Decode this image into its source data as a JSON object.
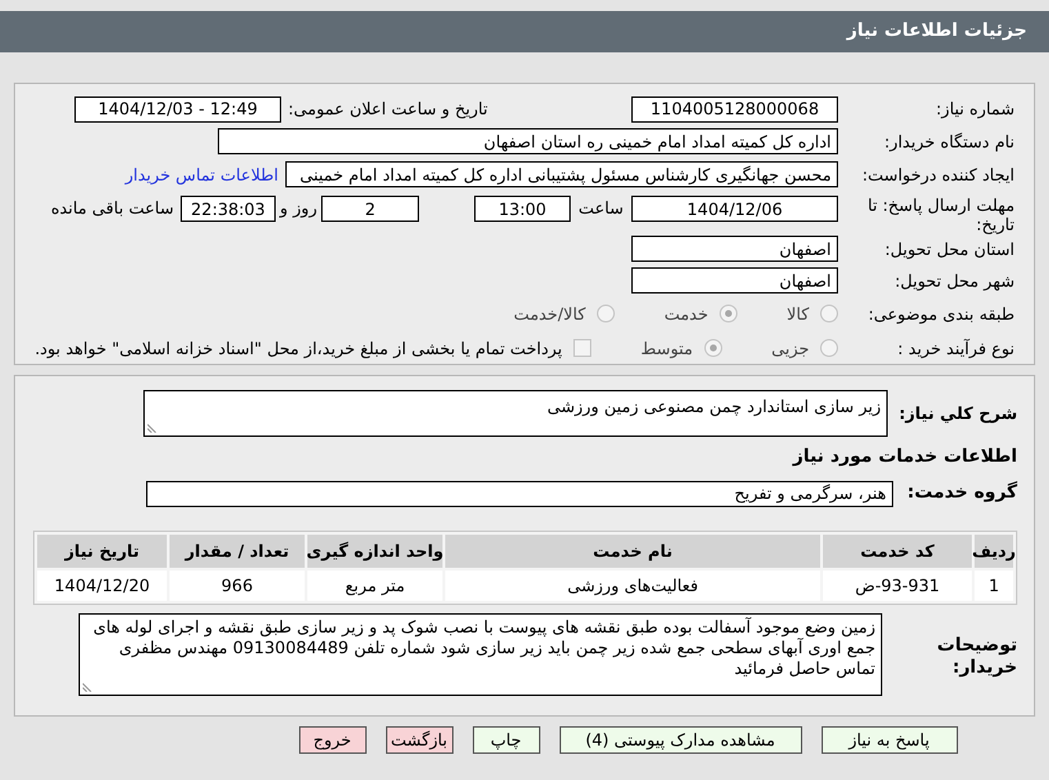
{
  "header": {
    "title": "جزئیات اطلاعات نیاز"
  },
  "details": {
    "need_number": {
      "label": "شماره نیاز:",
      "value": "1104005128000068"
    },
    "announce_datetime": {
      "label": "تاریخ و ساعت اعلان عمومی:",
      "value": "1404/12/03 - 12:49"
    },
    "buyer_org": {
      "label": "نام دستگاه خریدار:",
      "value": "اداره کل کمیته امداد امام خمینی  ره  استان اصفهان"
    },
    "requester": {
      "label": "ایجاد کننده درخواست:",
      "value": "محسن جهانگیری کارشناس مسئول پشتیبانی اداره کل کمیته امداد امام خمینی",
      "contact_link": "اطلاعات تماس خریدار"
    },
    "deadline": {
      "label": "مهلت ارسال پاسخ: تا تاریخ:",
      "date": "1404/12/06",
      "time_label": "ساعت",
      "time": "13:00",
      "days": "2",
      "days_label": "روز و",
      "remaining": "22:38:03",
      "remaining_label": "ساعت باقی مانده"
    },
    "province": {
      "label": "استان محل تحویل:",
      "value": "اصفهان"
    },
    "city": {
      "label": "شهر محل تحویل:",
      "value": "اصفهان"
    },
    "category": {
      "label": "طبقه بندی موضوعی:",
      "options": [
        {
          "label": "کالا",
          "selected": false
        },
        {
          "label": "خدمت",
          "selected": true
        },
        {
          "label": "کالا/خدمت",
          "selected": false
        }
      ]
    },
    "process": {
      "label": "نوع فرآیند خرید :",
      "options": [
        {
          "label": "جزیی",
          "selected": false
        },
        {
          "label": "متوسط",
          "selected": true
        }
      ],
      "treasury": {
        "checked": false,
        "text": "پرداخت تمام یا بخشی از مبلغ خرید،از محل \"اسناد خزانه اسلامی\" خواهد بود."
      }
    }
  },
  "description": {
    "label": "شرح کلي نیاز:",
    "value": "زیر سازی استاندارد چمن مصنوعی زمین ورزشی"
  },
  "services_heading": "اطلاعات خدمات مورد نیاز",
  "service_group": {
    "label": "گروه خدمت:",
    "value": "هنر، سرگرمی و تفریح"
  },
  "table": {
    "columns": [
      "ردیف",
      "کد خدمت",
      "نام خدمت",
      "واحد اندازه گیری",
      "تعداد / مقدار",
      "تاریخ نیاز"
    ],
    "rows": [
      [
        "1",
        "ض-93-931",
        "فعالیت‌های ورزشی",
        "متر مربع",
        "966",
        "1404/12/20"
      ]
    ]
  },
  "buyer_notes": {
    "label": "توضیحات خریدار:",
    "value": "زمین وضع موجود آسفالت بوده طبق نقشه های پیوست با نصب شوک پد و زیر سازی طبق نقشه و اجرای لوله های جمع اوری آبهای سطحی جمع شده زیر چمن باید زیر سازی شود شماره تلفن 09130084489 مهندس مظفری تماس حاصل فرمائید"
  },
  "buttons": [
    {
      "label": "پاسخ به نیاز",
      "kind": "primary"
    },
    {
      "label": "مشاهده مدارک پیوستی (4)",
      "kind": "primary"
    },
    {
      "label": "چاپ",
      "kind": "primary"
    },
    {
      "label": "بازگشت",
      "kind": "danger"
    },
    {
      "label": "خروج",
      "kind": "danger"
    }
  ]
}
